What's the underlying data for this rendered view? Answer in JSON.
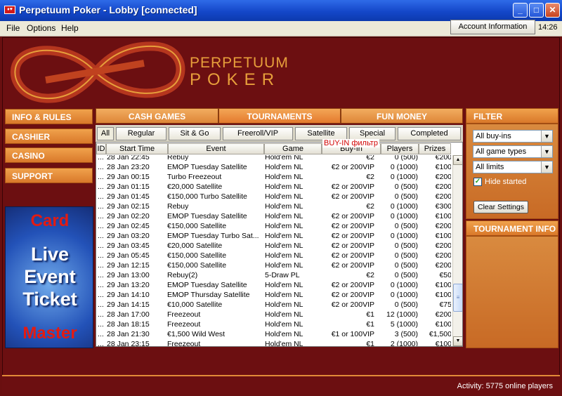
{
  "window": {
    "title": "Perpetuum Poker - Lobby [connected]",
    "app_icon": "cards-icon",
    "minimize": "_",
    "maximize": "□",
    "close": "✕"
  },
  "menu": {
    "items": [
      "File",
      "Options",
      "Help"
    ],
    "account_button": "Account Information",
    "clock": "14:26"
  },
  "brand": {
    "line1": "PERPETUUM",
    "line2": "POKER"
  },
  "left_nav": [
    "INFO & RULES",
    "CASHIER",
    "CASINO",
    "SUPPORT"
  ],
  "banner": {
    "top": "Card",
    "l1": "Live",
    "l2": "Event",
    "l3": "Ticket",
    "bottom": "Master"
  },
  "tabs": [
    "CASH GAMES",
    "TOURNAMENTS",
    "FUN MONEY"
  ],
  "subtabs": [
    "All",
    "Regular",
    "Sit & Go",
    "Freeroll/VIP",
    "Satellite",
    "Special",
    "Completed"
  ],
  "columns": [
    "ID",
    "Start Time",
    "Event",
    "Game",
    "Buy-In",
    "Players",
    "Prizes"
  ],
  "buyin_overlay": "BUY-IN фильтр",
  "rows": [
    [
      "...",
      "28 Jan 22:45",
      "Rebuy",
      "Hold'em NL",
      "€2",
      "0 (500)",
      "€200"
    ],
    [
      "...",
      "28 Jan 23:20",
      "EMOP Tuesday Satellite",
      "Hold'em NL",
      "€2 or 200VIP",
      "0 (1000)",
      "€100"
    ],
    [
      "...",
      "29 Jan 00:15",
      "Turbo Freezeout",
      "Hold'em NL",
      "€2",
      "0 (1000)",
      "€200"
    ],
    [
      "...",
      "29 Jan 01:15",
      "€20,000 Satellite",
      "Hold'em NL",
      "€2 or 200VIP",
      "0 (500)",
      "€200"
    ],
    [
      "...",
      "29 Jan 01:45",
      "€150,000 Turbo Satellite",
      "Hold'em NL",
      "€2 or 200VIP",
      "0 (500)",
      "€200"
    ],
    [
      "...",
      "29 Jan 02:15",
      "Rebuy",
      "Hold'em NL",
      "€2",
      "0 (1000)",
      "€300"
    ],
    [
      "...",
      "29 Jan 02:20",
      "EMOP Tuesday Satellite",
      "Hold'em NL",
      "€2 or 200VIP",
      "0 (1000)",
      "€100"
    ],
    [
      "...",
      "29 Jan 02:45",
      "€150,000 Satellite",
      "Hold'em NL",
      "€2 or 200VIP",
      "0 (500)",
      "€200"
    ],
    [
      "...",
      "29 Jan 03:20",
      "EMOP Tuesday Turbo Sat...",
      "Hold'em NL",
      "€2 or 200VIP",
      "0 (1000)",
      "€100"
    ],
    [
      "...",
      "29 Jan 03:45",
      "€20,000 Satellite",
      "Hold'em NL",
      "€2 or 200VIP",
      "0 (500)",
      "€200"
    ],
    [
      "...",
      "29 Jan 05:45",
      "€150,000 Satellite",
      "Hold'em NL",
      "€2 or 200VIP",
      "0 (500)",
      "€200"
    ],
    [
      "...",
      "29 Jan 12:15",
      "€150,000 Satellite",
      "Hold'em NL",
      "€2 or 200VIP",
      "0 (500)",
      "€200"
    ],
    [
      "...",
      "29 Jan 13:00",
      "Rebuy(2)",
      "5-Draw PL",
      "€2",
      "0 (500)",
      "€50"
    ],
    [
      "...",
      "29 Jan 13:20",
      "EMOP Tuesday Satellite",
      "Hold'em NL",
      "€2 or 200VIP",
      "0 (1000)",
      "€100"
    ],
    [
      "...",
      "29 Jan 14:10",
      "EMOP Thursday Satellite",
      "Hold'em NL",
      "€2 or 200VIP",
      "0 (1000)",
      "€100"
    ],
    [
      "...",
      "29 Jan 14:15",
      "€10,000 Satellite",
      "Hold'em NL",
      "€2 or 200VIP",
      "0 (500)",
      "€75"
    ],
    [
      "...",
      "28 Jan 17:00",
      "Freezeout",
      "Hold'em NL",
      "€1",
      "12 (1000)",
      "€200"
    ],
    [
      "...",
      "28 Jan 18:15",
      "Freezeout",
      "Hold'em NL",
      "€1",
      "5 (1000)",
      "€100"
    ],
    [
      "...",
      "28 Jan 21:30",
      "€1,500 Wild West",
      "Hold'em NL",
      "€1 or 100VIP",
      "3 (500)",
      "€1,500"
    ],
    [
      "...",
      "28 Jan 23:15",
      "Freezeout",
      "Hold'em NL",
      "€1",
      "2 (1000)",
      "€100"
    ]
  ],
  "filter": {
    "title": "FILTER",
    "buyins": "All buy-ins",
    "game_types": "All game types",
    "limits": "All limits",
    "hide_started": "Hide started",
    "hide_started_checked": true,
    "clear": "Clear Settings"
  },
  "tournament_info": {
    "title": "TOURNAMENT INFO"
  },
  "status": {
    "activity": "Activity: 5775 online players"
  }
}
